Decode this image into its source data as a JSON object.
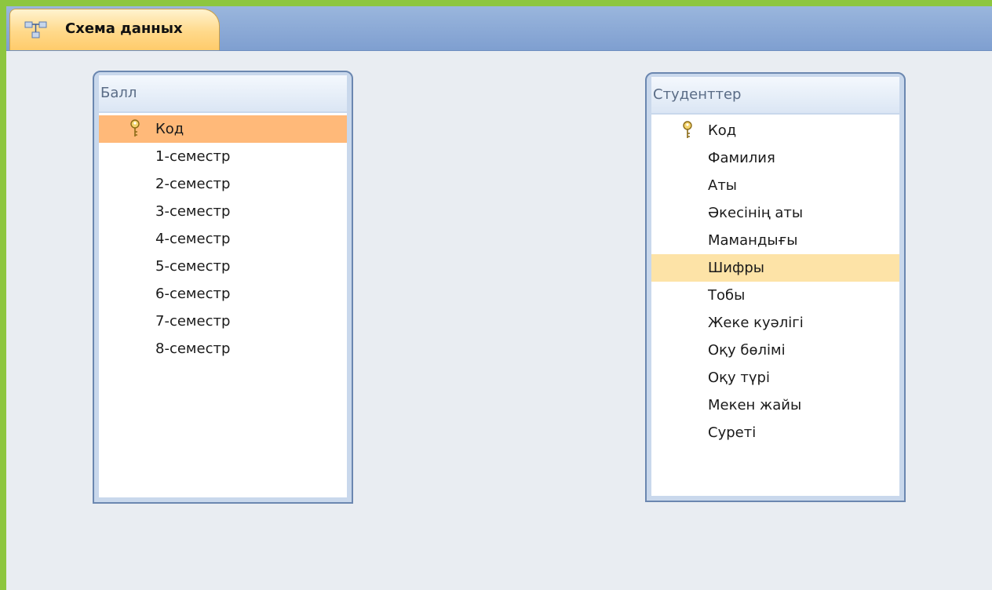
{
  "tab": {
    "label": "Схема данных",
    "icon": "relationships-icon"
  },
  "tables": [
    {
      "title": "Балл",
      "fields": [
        {
          "label": "Код",
          "primary_key": true,
          "state": "selected"
        },
        {
          "label": "1-семестр"
        },
        {
          "label": "2-семестр"
        },
        {
          "label": "3-семестр"
        },
        {
          "label": "4-семестр"
        },
        {
          "label": "5-семестр"
        },
        {
          "label": "6-семестр"
        },
        {
          "label": "7-семестр"
        },
        {
          "label": "8-семестр"
        }
      ]
    },
    {
      "title": "Студенттер",
      "fields": [
        {
          "label": "Код",
          "primary_key": true
        },
        {
          "label": "Фамилия"
        },
        {
          "label": "Аты"
        },
        {
          "label": "Әкесінің аты"
        },
        {
          "label": "Мамандығы"
        },
        {
          "label": "Шифры",
          "state": "hover"
        },
        {
          "label": "Тобы"
        },
        {
          "label": "Жеке куәлігі"
        },
        {
          "label": "Оқу бөлімі"
        },
        {
          "label": "Оқу түрі"
        },
        {
          "label": "Мекен жайы"
        },
        {
          "label": "Суреті"
        }
      ]
    }
  ],
  "colors": {
    "outer_border": "#8dc63f",
    "canvas": "#e9edf2",
    "tab_bar": "#8aa9d6",
    "selected_row": "#ffb979",
    "hover_row": "#fde3a7"
  }
}
